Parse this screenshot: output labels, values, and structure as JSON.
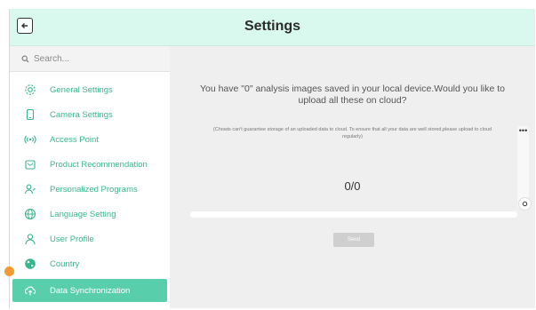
{
  "header": {
    "title": "Settings",
    "back_icon": "arrow-left-icon"
  },
  "search": {
    "placeholder": "Search..."
  },
  "sidebar": {
    "items": [
      {
        "label": "General Settings",
        "icon": "gear-icon"
      },
      {
        "label": "Camera Settings",
        "icon": "phone-icon"
      },
      {
        "label": "Access Point",
        "icon": "wireless-icon"
      },
      {
        "label": "Product Recommendation",
        "icon": "bag-icon"
      },
      {
        "label": "Personalized Programs",
        "icon": "user-edit-icon"
      },
      {
        "label": "Language Setting",
        "icon": "globe-icon"
      },
      {
        "label": "User Profile",
        "icon": "user-icon"
      },
      {
        "label": "Country",
        "icon": "earth-icon"
      },
      {
        "label": "Data Synchronization",
        "icon": "cloud-upload-icon",
        "active": true
      }
    ]
  },
  "main": {
    "message": "You have \"0\" analysis images saved in your local device.Would you like to upload all these on cloud?",
    "note": "(Chowis can't guarantee storage of an uploaded data to cloud. To ensure that all your data are well stored,please upload to cloud regularly)",
    "counter": "0/0",
    "progress": 0,
    "send_label": "Send",
    "more_icon": "ellipsis-icon"
  },
  "colors": {
    "accent": "#58cfaa",
    "accent_text": "#39b58e",
    "header_bg": "#d9f8ee",
    "orange": "#f39a34"
  }
}
